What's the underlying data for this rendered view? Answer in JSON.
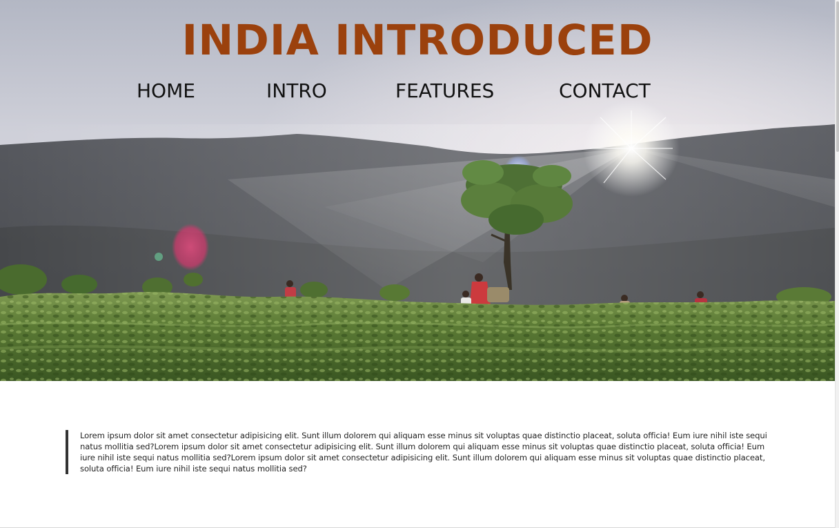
{
  "header": {
    "title": "INDIA INTRODUCED"
  },
  "nav": {
    "items": [
      {
        "label": "HOME"
      },
      {
        "label": "INTRO"
      },
      {
        "label": "FEATURES"
      },
      {
        "label": "CONTACT"
      }
    ]
  },
  "hero": {
    "image": "tea-plantation-landscape-with-sunrise-and-workers"
  },
  "main": {
    "quote": "Lorem ipsum dolor sit amet consectetur adipisicing elit. Sunt illum dolorem qui aliquam esse minus sit voluptas quae distinctio placeat, soluta officia! Eum iure nihil iste sequi natus mollitia sed?Lorem ipsum dolor sit amet consectetur adipisicing elit. Sunt illum dolorem qui aliquam esse minus sit voluptas quae distinctio placeat, soluta officia! Eum iure nihil iste sequi natus mollitia sed?Lorem ipsum dolor sit amet consectetur adipisicing elit. Sunt illum dolorem qui aliquam esse minus sit voluptas quae distinctio placeat, soluta officia! Eum iure nihil iste sequi natus mollitia sed?"
  },
  "colors": {
    "title": "#9b410d",
    "nav_text": "#111111",
    "quote_border": "#333333"
  }
}
